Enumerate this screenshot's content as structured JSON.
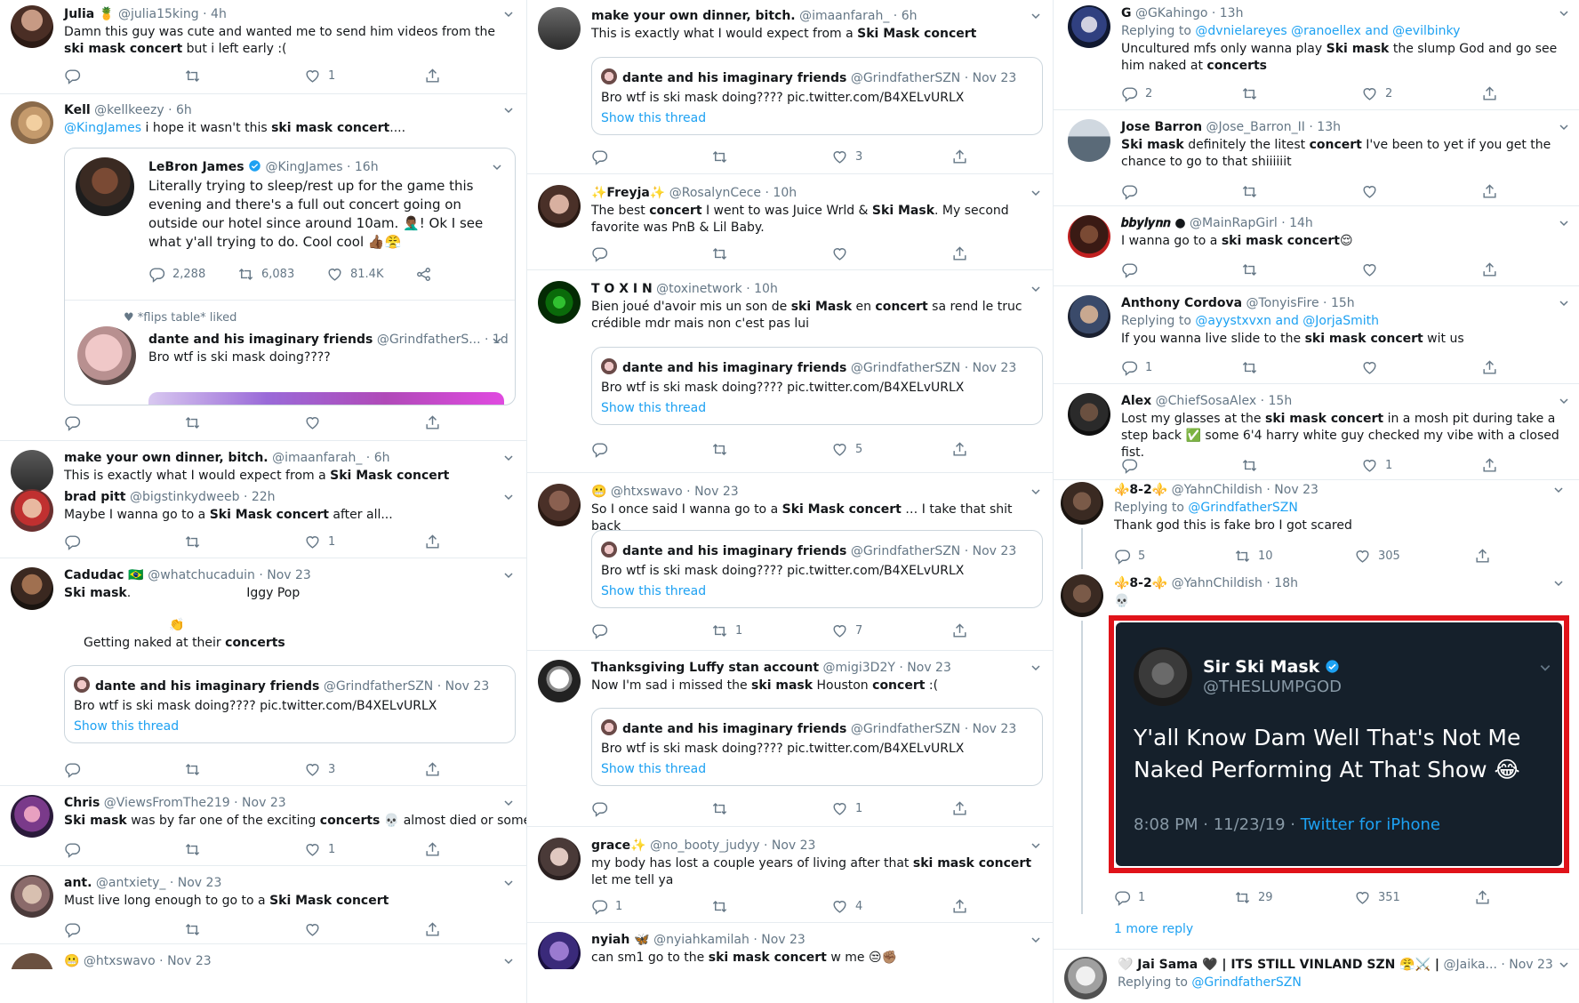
{
  "col1": {
    "t1": {
      "name": "Julia 🍍",
      "handle": "@julia15king",
      "time": "· 4h",
      "text1": "Damn this guy was cute and wanted me to send him videos from the ",
      "bold1": "ski mask concert",
      "text2": " but i left early :(",
      "likes": "1"
    },
    "t2": {
      "name": "Kell",
      "handle": "@kellkeezy",
      "time": "· 6h",
      "mention": "@KingJames",
      "text1": " i hope it wasn't this ",
      "bold1": "ski mask concert",
      "text2": "...."
    },
    "lebron": {
      "name": "LeBron James",
      "handle": "@KingJames",
      "time": "· 16h",
      "text": "Literally trying to sleep/rest up for the game this evening and there's a full out concert going on outside our hotel since around 10am. 🤦🏾‍♂️! Ok I see what y'all trying to do. Cool cool 👍🏾😤",
      "replies": "2,288",
      "retweets": "6,083",
      "likes": "81.4K",
      "liked": "*flips table* liked",
      "qname": "dante and his imaginary friends",
      "qhandle": "@GrindfatherS...",
      "qtime": "· 1d",
      "qtext": "Bro wtf is ski mask doing????"
    },
    "t3": {
      "name": "make your own dinner, bitch.",
      "handle": "@imaanfarah_",
      "time": "· 6h",
      "text1": "This is exactly what I would expect from a ",
      "bold1": "Ski Mask concert"
    },
    "t4": {
      "name": "brad pitt",
      "handle": "@bigstinkydweeb",
      "time": "· 22h",
      "text1": "Maybe I wanna go to a ",
      "bold1": "Ski Mask concert",
      "text2": " after all...",
      "likes": "1"
    },
    "t5": {
      "name": "Cadudac 🇧🇷",
      "handle": "@whatchucaduin",
      "time": "· Nov 23",
      "bold1": "Ski mask",
      "text2": ".",
      "iggy": "Iggy Pop",
      "emoji": "👏",
      "naked": "Getting naked at their ",
      "bold2": "concerts",
      "likes": "3"
    },
    "t6": {
      "name": "Chris",
      "handle": "@ViewsFromThe219",
      "time": "· Nov 23",
      "bold1": "Ski mask",
      "text1": " was by far one of the exciting ",
      "bold2": "concerts",
      "text2": " 💀 almost died or some.",
      "likes": "1"
    },
    "t7": {
      "name": "ant.",
      "handle": "@antxiety_",
      "time": "· Nov 23",
      "text1": "Must live long enough to go to a ",
      "bold1": "Ski Mask concert"
    },
    "t8": {
      "name": "😬",
      "handle": "@htxswavo",
      "time": "· Nov 23"
    }
  },
  "quote": {
    "name": "dante and his imaginary friends",
    "handle": "@GrindfatherSZN",
    "time": "· Nov 23",
    "text": "Bro wtf is ski mask doing???? pic.twitter.com/B4XELvURLX",
    "show": "Show this thread"
  },
  "col2": {
    "t1": {
      "name": "make your own dinner, bitch.",
      "handle": "@imaanfarah_",
      "time": "· 6h",
      "text1": "This is exactly what I would expect from a ",
      "bold1": "Ski Mask concert",
      "likes": "3"
    },
    "t2": {
      "name": "✨Freyja✨",
      "handle": "@RosalynCece",
      "time": "· 10h",
      "text1": "The best ",
      "bold1": "concert",
      "text2": " I went to was Juice Wrld & ",
      "bold2": "Ski Mask",
      "text3": ". My second favorite was PnB & Lil Baby."
    },
    "t3": {
      "name": "T O X I N",
      "handle": "@toxinetwork",
      "time": "· 10h",
      "text1": "Bien joué d'avoir mis un son de ",
      "bold1": "ski Mask",
      "text2": " en ",
      "bold2": "concert",
      "text3": " sa rend le truc crédible mdr mais non c'est pas lui",
      "likes": "5"
    },
    "t4": {
      "name": "😬",
      "handle": "@htxswavo",
      "time": "· Nov 23",
      "text1": "So I once said I wanna go to a ",
      "bold1": "Ski Mask concert",
      "text2": " … I take that shit back",
      "retweets": "1",
      "likes": "7"
    },
    "t5": {
      "name": "Thanksgiving Luffy stan account",
      "handle": "@migi3D2Y",
      "time": "· Nov 23",
      "text1": "Now I'm sad i missed the ",
      "bold1": "ski mask",
      "text2": " Houston ",
      "bold2": "concert",
      "text3": " :(",
      "likes": "1"
    },
    "t6": {
      "name": "grace✨",
      "handle": "@no_booty_judyy",
      "time": "· Nov 23",
      "text1": "my body has lost a couple years of living after that ",
      "bold1": "ski mask concert",
      "text2": " let me tell ya",
      "replies": "1",
      "likes": "4"
    },
    "t7": {
      "name": "nyiah 🦋",
      "handle": "@nyiahkamilah",
      "time": "· Nov 23",
      "text1": "can sm1 go to the ",
      "bold1": "ski mask concert",
      "text2": " w me 😒✊🏽"
    }
  },
  "col3": {
    "t1": {
      "name": "G",
      "handle": "@GKahingo",
      "time": "· 13h",
      "replying": "Replying to ",
      "rlinks": "@dvnielareyes @ranoellex and @evilbinky",
      "text1": "Uncultured mfs only wanna play ",
      "bold1": "Ski mask",
      "text2": " the slump God and go see him naked at ",
      "bold2": "concerts",
      "replies": "2",
      "likes": "2"
    },
    "t2": {
      "name": "Jose Barron",
      "handle": "@Jose_Barron_II",
      "time": "· 13h",
      "bold1": "Ski mask",
      "text1": " definitely the litest ",
      "bold2": "concert",
      "text2": " I've been to yet if you get the chance to go to that shiiiiiit"
    },
    "t3": {
      "name": "𝒃𝒃𝒚𝒍𝒚𝒏𝒏 ●",
      "handle": "@MainRapGirl",
      "time": "· 14h",
      "text1": "I wanna go to a ",
      "bold1": "ski mask concert",
      "text2": "😌"
    },
    "t4": {
      "name": "Anthony Cordova",
      "handle": "@TonyisFire",
      "time": "· 15h",
      "replying": "Replying to ",
      "rlinks": "@ayystxvxn and @JorjaSmith",
      "text1": "If you wanna live slide to the ",
      "bold1": "ski mask concert",
      "text2": " wit us",
      "replies": "1"
    },
    "t5": {
      "name": "Alex",
      "handle": "@ChiefSosaAlex",
      "time": "· 15h",
      "text1": "Lost my glasses at the ",
      "bold1": "ski mask concert",
      "text2": " in a mosh pit during take a step back ✅ some 6'4 harry white guy checked my vibe with a closed fist.",
      "likes": "1"
    },
    "t6": {
      "name": "⚜️8-2⚜️",
      "handle": "@YahnChildish",
      "time": "· Nov 23",
      "replying": "Replying to ",
      "rlinks": "@GrindfatherSZN",
      "text": "Thank god this is fake bro I got scared",
      "replies": "5",
      "retweets": "10",
      "likes": "305"
    },
    "t7": {
      "name": "⚜️8-2⚜️",
      "handle": "@YahnChildish",
      "time": "· 18h",
      "text": "💀",
      "replies": "1",
      "retweets": "29",
      "likes": "351",
      "more": "1 more reply"
    },
    "embed": {
      "name": "Sir Ski Mask",
      "handle": "@THESLUMPGOD",
      "line1": "Y'all Know Dam Well That's Not Me",
      "line2": "Naked Performing At That Show 😂",
      "ts": "8:08 PM · 11/23/19 · ",
      "via": "Twitter for iPhone"
    },
    "t8": {
      "name": "🤍 Jai Sama 🖤 | ITS STILL VINLAND SZN 😤⚔️ |",
      "handle": "@Jaika...",
      "time": "· Nov 23",
      "replying": "Replying to ",
      "rlinks": "@GrindfatherSZN"
    }
  },
  "colors": {
    "accent": "#1da1f2",
    "text": "#14171a",
    "muted": "#657786",
    "border": "#e6ecf0",
    "highlight": "#e0131a"
  }
}
